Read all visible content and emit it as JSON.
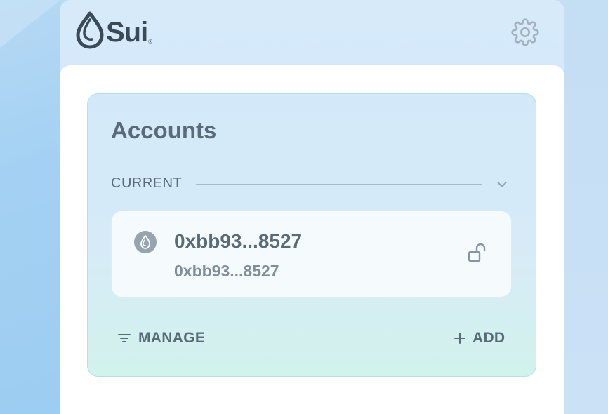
{
  "app": {
    "brand": "Sui",
    "brand_mark": "®"
  },
  "header": {
    "logo_icon": "sui-drop-logo",
    "settings_icon": "gear-icon"
  },
  "accounts": {
    "title": "Accounts",
    "section_label": "CURRENT",
    "items": [
      {
        "name": "0xbb93...8527",
        "address": "0xbb93...8527",
        "icon": "sui-drop-icon",
        "status_icon": "unlocked-padlock-icon"
      }
    ],
    "manage_label": "MANAGE",
    "add_label": "ADD"
  },
  "colors": {
    "text_primary": "#5a6b78",
    "text_secondary": "#7e8e9a",
    "card_border": "#b7dcee",
    "background": "#cfe6f8"
  }
}
